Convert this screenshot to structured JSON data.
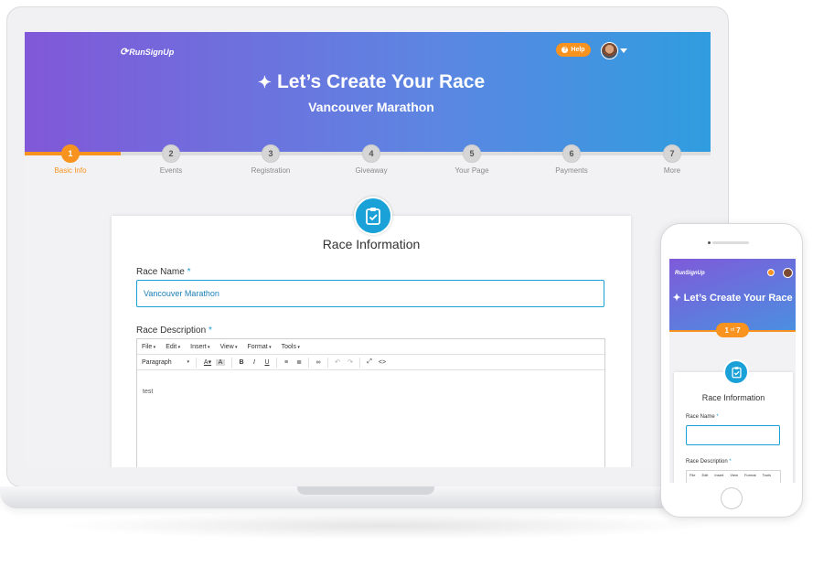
{
  "desktop": {
    "header": {
      "logo": "RunSignUp",
      "help_label": "Help",
      "title": "Let’s Create Your Race",
      "subtitle": "Vancouver Marathon"
    },
    "steps": [
      {
        "num": "1",
        "label": "Basic Info",
        "active": true
      },
      {
        "num": "2",
        "label": "Events",
        "active": false
      },
      {
        "num": "3",
        "label": "Registration",
        "active": false
      },
      {
        "num": "4",
        "label": "Giveaway",
        "active": false
      },
      {
        "num": "5",
        "label": "Your Page",
        "active": false
      },
      {
        "num": "6",
        "label": "Payments",
        "active": false
      },
      {
        "num": "7",
        "label": "More",
        "active": false
      }
    ],
    "progress_fraction": 0.14,
    "card": {
      "title": "Race Information",
      "race_name_label": "Race Name",
      "race_name_value": "Vancouver Marathon",
      "race_desc_label": "Race Description",
      "required_mark": "*",
      "editor_menu": [
        "File",
        "Edit",
        "Insert",
        "View",
        "Format",
        "Tools"
      ],
      "editor_format": "Paragraph",
      "editor_text": "test"
    }
  },
  "mobile": {
    "logo": "RunSignUp",
    "title": "Let’s Create Your Race",
    "step_current": "1",
    "step_of": "of",
    "step_total": "7",
    "card": {
      "title": "Race Information",
      "race_name_label": "Race Name",
      "race_desc_label": "Race Description",
      "required_mark": "*",
      "editor_menu": [
        "File",
        "Edit",
        "Insert",
        "View",
        "Format",
        "Tools"
      ]
    }
  },
  "colors": {
    "accent": "#f7931e",
    "brand_blue": "#1aa1d8",
    "gradient_start": "#8158d8",
    "gradient_end": "#2f9ddf"
  }
}
